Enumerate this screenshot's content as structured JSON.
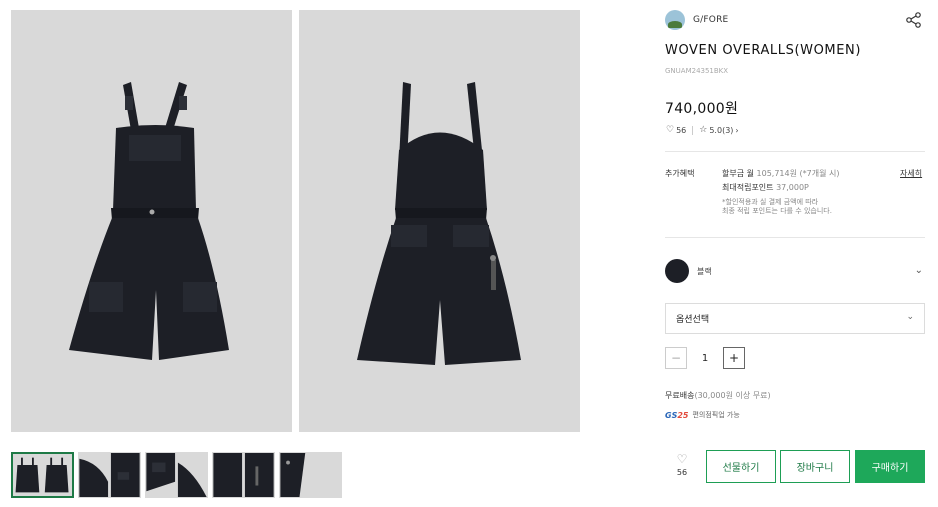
{
  "brand": {
    "name": "G/FORE",
    "logo_icon": "brand-avatar"
  },
  "product": {
    "title": "WOVEN OVERALLS(WOMEN)",
    "code": "GNUAM24351BKX",
    "price": "740,000원",
    "likes": "56",
    "rating": "5.0",
    "review_count": "(3)"
  },
  "benefits": {
    "label": "추가혜택",
    "installment_label": "할부금 월 ",
    "installment_value": "105,714원 (*7개월 시)",
    "points_label": "최대적립포인트 ",
    "points_value": "37,000P",
    "note_line1": "*할인적용과 실 결제 금액에 따라",
    "note_line2": "최종 적립 포인트는 다를 수 있습니다.",
    "detail_link": "자세히"
  },
  "color": {
    "name": "블랙",
    "hex": "#1d1f26"
  },
  "option": {
    "placeholder": "옵션선택"
  },
  "quantity": {
    "value": "1",
    "minus": "−",
    "plus": "+"
  },
  "shipping": {
    "prefix": "무료배송",
    "condition": "(30,000원 이상 무료)"
  },
  "partner": {
    "logo_main": "GS",
    "logo_accent": "25",
    "text": "편의점픽업 가능"
  },
  "actions": {
    "wish_count": "56",
    "gift": "선물하기",
    "cart": "장바구니",
    "buy": "구매하기"
  },
  "colors": {
    "accent": "#1ea85a",
    "accent_dark": "#1e7a46",
    "image_bg": "#d9d9d9",
    "garment": "#1d1f26"
  }
}
